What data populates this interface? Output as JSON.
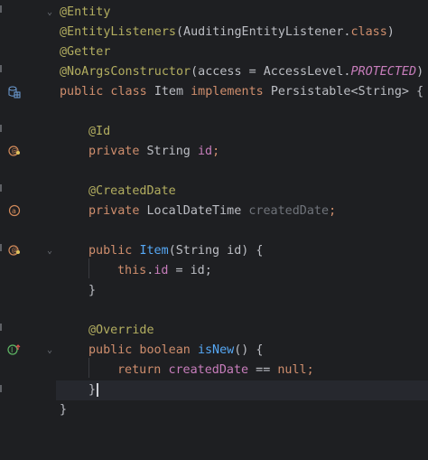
{
  "editor": {
    "lines": {
      "l1": {
        "a": "@Entity"
      },
      "l2": {
        "a": "@EntityListeners",
        "b": "(AuditingEntityListener.",
        "c": "class",
        "d": ")"
      },
      "l3": {
        "a": "@Getter"
      },
      "l4": {
        "a": "@NoArgsConstructor",
        "b": "(access = AccessLevel.",
        "c": "PROTECTED",
        "d": ")"
      },
      "l5": {
        "a": "public class ",
        "b": "Item ",
        "c": "implements ",
        "d": "Persistable<String> {"
      },
      "l7": {
        "a": "@Id"
      },
      "l8": {
        "a": "private ",
        "b": "String ",
        "c": "id",
        "d": ";"
      },
      "l10": {
        "a": "@CreatedDate"
      },
      "l11": {
        "a": "private ",
        "b": "LocalDateTime ",
        "c": "createdDate",
        "d": ";"
      },
      "l13": {
        "a": "public ",
        "b": "Item",
        "c": "(String id) {"
      },
      "l14": {
        "a": "this",
        "b": ".",
        "c": "id",
        "d": " = id;"
      },
      "l15": {
        "a": "}"
      },
      "l17": {
        "a": "@Override"
      },
      "l18": {
        "a": "public boolean ",
        "b": "isNew",
        "c": "() {"
      },
      "l19": {
        "a": "return ",
        "b": "createdDate",
        "c": " == ",
        "d": "null",
        "e": ";"
      },
      "l20": {
        "a": "}"
      },
      "l21": {
        "a": "}"
      }
    }
  },
  "gutter_icons": {
    "entity": "database-table-icon",
    "id_field": "primary-key-field-icon",
    "created_field": "annotated-field-icon",
    "constructor": "constructor-icon",
    "override": "implements-override-icon"
  },
  "colors": {
    "background": "#1e1f22",
    "keyword": "#cf8e6d",
    "annotation": "#b3ae60",
    "method": "#56a8f5",
    "field": "#c77dbb",
    "text": "#bcbec4"
  }
}
